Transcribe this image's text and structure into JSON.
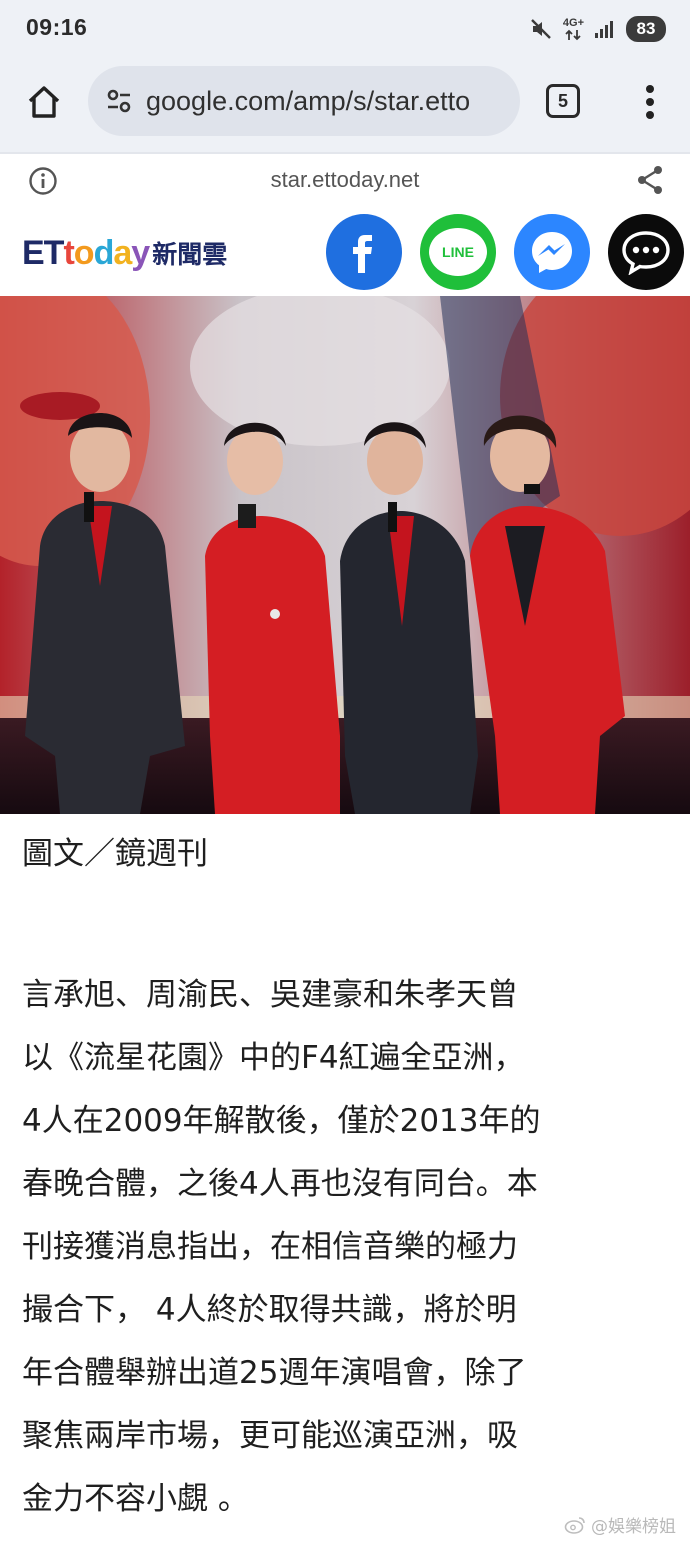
{
  "status_bar": {
    "time": "09:16",
    "network": "4G+",
    "battery": "83",
    "icons": [
      "mute-icon",
      "network-icon",
      "signal-icon",
      "battery-icon"
    ]
  },
  "browser": {
    "url": "google.com/amp/s/star.etto",
    "tab_count": "5",
    "icons": [
      "home-icon",
      "site-settings-icon",
      "tabs-icon",
      "more-vert-icon"
    ]
  },
  "amp_bar": {
    "host": "star.ettoday.net",
    "icons": [
      "info-icon",
      "share-icon"
    ]
  },
  "site_header": {
    "logo_et": "ET",
    "logo_today": [
      "t",
      "o",
      "d",
      "a",
      "y"
    ],
    "logo_today_colors": [
      "#e8463c",
      "#f39a1e",
      "#2aa7d6",
      "#f2b21f",
      "#8a55b8"
    ],
    "logo_cn": "新聞雲",
    "logo_primary_color": "#1e2a66",
    "share_buttons": [
      {
        "name": "facebook",
        "icon": "facebook-icon",
        "color": "#1f6fe0"
      },
      {
        "name": "line",
        "icon": "line-icon",
        "label": "LINE",
        "color": "#1fbf3a"
      },
      {
        "name": "messenger",
        "icon": "messenger-icon",
        "color": "#2c86ff"
      },
      {
        "name": "comment",
        "icon": "comment-icon",
        "color": "#0b0b0b"
      }
    ]
  },
  "article": {
    "credit": "圖文／鏡週刊",
    "lines": [
      "言承旭、周渝民、吳建豪和朱孝天曾",
      "以《流星花園》中的F4紅遍全亞洲，",
      "4人在2009年解散後，僅於2013年的",
      "春晚合體，之後4人再也沒有同台。本",
      "刊接獲消息指出，在相信音樂的極力",
      "撮合下， 4人終於取得共識，將於明",
      "年合體舉辦出道25週年演唱會，除了",
      "聚焦兩岸市場，更可能巡演亞洲，吸",
      "金力不容小覷 。"
    ]
  },
  "watermark": {
    "text": "@娛樂榜姐",
    "icon": "weibo-icon"
  }
}
